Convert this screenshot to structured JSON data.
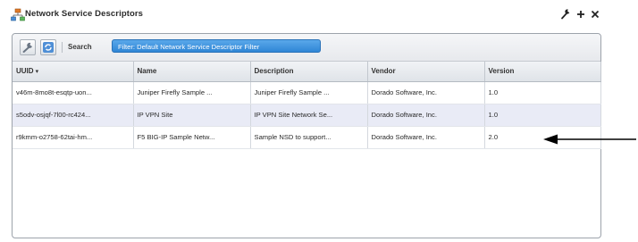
{
  "window": {
    "title": "Network Service Descriptors",
    "icons": [
      "network-tree-icon",
      "wrench-icon",
      "plus-icon",
      "close-icon"
    ]
  },
  "toolbar": {
    "search_label": "Search",
    "filter_label": "Filter: Default Network Service Descriptor Filter",
    "icons": [
      "wrench-icon",
      "refresh-icon"
    ]
  },
  "table": {
    "columns": [
      "UUID",
      "Name",
      "Description",
      "Vendor",
      "Version"
    ],
    "sort_indicator": "▾",
    "rows": [
      [
        "v46m-8mo8t-esqtp-uon...",
        "Juniper Firefly Sample ...",
        "Juniper Firefly Sample ...",
        "Dorado Software, Inc.",
        "1.0"
      ],
      [
        "s5odv-osjqf-7l00-rc424...",
        "IP VPN Site",
        "IP VPN Site Network Se...",
        "Dorado Software, Inc.",
        "1.0"
      ],
      [
        "r9kmm-o2758-62tai-hm...",
        "F5 BIG-IP Sample Netw...",
        "Sample NSD to support...",
        "Dorado Software, Inc.",
        "2.0"
      ]
    ]
  },
  "colors": {
    "filter_chip": "#2f86d6",
    "row_alt": "#e9ebf6",
    "panel_border": "#9da3ab"
  }
}
